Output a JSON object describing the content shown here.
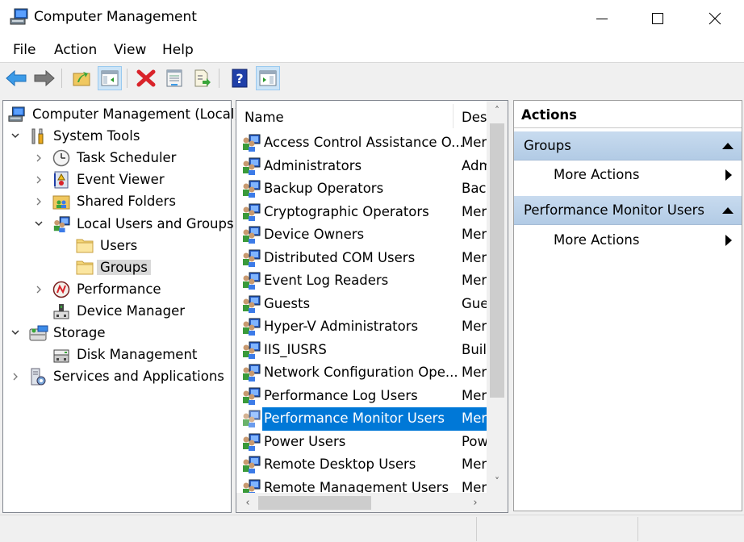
{
  "window": {
    "title": "Computer Management",
    "app_icon": "computer-management-icon",
    "controls": [
      "minimize",
      "maximize",
      "close"
    ]
  },
  "menu": [
    "File",
    "Action",
    "View",
    "Help"
  ],
  "toolbar": [
    {
      "name": "back",
      "icon": "back-arrow-icon"
    },
    {
      "name": "forward",
      "icon": "forward-arrow-icon"
    },
    {
      "name": "up-one-level",
      "icon": "up-folder-icon"
    },
    {
      "name": "show-hide-console-tree",
      "icon": "console-tree-icon",
      "pressed": true
    },
    {
      "name": "delete",
      "icon": "delete-x-icon"
    },
    {
      "name": "properties",
      "icon": "properties-icon"
    },
    {
      "name": "export-list",
      "icon": "export-list-icon"
    },
    {
      "name": "help",
      "icon": "help-icon"
    },
    {
      "name": "show-hide-action-pane",
      "icon": "action-pane-icon",
      "pressed": true
    }
  ],
  "tree": [
    {
      "label": "Computer Management (Local)",
      "icon": "computer-management-icon",
      "level": 0,
      "expander": "none"
    },
    {
      "label": "System Tools",
      "icon": "tools-icon",
      "level": 1,
      "expander": "expanded"
    },
    {
      "label": "Task Scheduler",
      "icon": "clock-icon",
      "level": 2,
      "expander": "collapsed"
    },
    {
      "label": "Event Viewer",
      "icon": "event-viewer-icon",
      "level": 2,
      "expander": "collapsed"
    },
    {
      "label": "Shared Folders",
      "icon": "shared-folder-icon",
      "level": 2,
      "expander": "collapsed"
    },
    {
      "label": "Local Users and Groups",
      "icon": "users-groups-icon",
      "level": 2,
      "expander": "expanded"
    },
    {
      "label": "Users",
      "icon": "folder-icon",
      "level": 3,
      "expander": "none"
    },
    {
      "label": "Groups",
      "icon": "folder-icon",
      "level": 3,
      "expander": "none",
      "selected": true
    },
    {
      "label": "Performance",
      "icon": "performance-icon",
      "level": 2,
      "expander": "collapsed"
    },
    {
      "label": "Device Manager",
      "icon": "device-manager-icon",
      "level": 2,
      "expander": "none"
    },
    {
      "label": "Storage",
      "icon": "storage-icon",
      "level": 1,
      "expander": "expanded"
    },
    {
      "label": "Disk Management",
      "icon": "disk-management-icon",
      "level": 2,
      "expander": "none"
    },
    {
      "label": "Services and Applications",
      "icon": "services-icon",
      "level": 1,
      "expander": "collapsed"
    }
  ],
  "list": {
    "columns": [
      "Name",
      "Desc"
    ],
    "rows": [
      {
        "name": "Access Control Assistance O...",
        "desc": "Mer"
      },
      {
        "name": "Administrators",
        "desc": "Adm"
      },
      {
        "name": "Backup Operators",
        "desc": "Back"
      },
      {
        "name": "Cryptographic Operators",
        "desc": "Mer"
      },
      {
        "name": "Device Owners",
        "desc": "Mer"
      },
      {
        "name": "Distributed COM Users",
        "desc": "Mer"
      },
      {
        "name": "Event Log Readers",
        "desc": "Mer"
      },
      {
        "name": "Guests",
        "desc": "Gue"
      },
      {
        "name": "Hyper-V Administrators",
        "desc": "Mer"
      },
      {
        "name": "IIS_IUSRS",
        "desc": "Buil"
      },
      {
        "name": "Network Configuration Ope...",
        "desc": "Mer"
      },
      {
        "name": "Performance Log Users",
        "desc": "Mer"
      },
      {
        "name": "Performance Monitor Users",
        "desc": "Mer",
        "selected": true
      },
      {
        "name": "Power Users",
        "desc": "Pow"
      },
      {
        "name": "Remote Desktop Users",
        "desc": "Mer"
      },
      {
        "name": "Remote Management Users",
        "desc": "Mer"
      }
    ]
  },
  "actions": {
    "title": "Actions",
    "sections": [
      {
        "title": "Groups",
        "items": [
          "More Actions"
        ]
      },
      {
        "title": "Performance Monitor Users",
        "items": [
          "More Actions"
        ]
      }
    ]
  },
  "colors": {
    "selection": "#0078d7",
    "tree_selection": "#d9d9d9",
    "action_header": "#b9d1ea"
  }
}
